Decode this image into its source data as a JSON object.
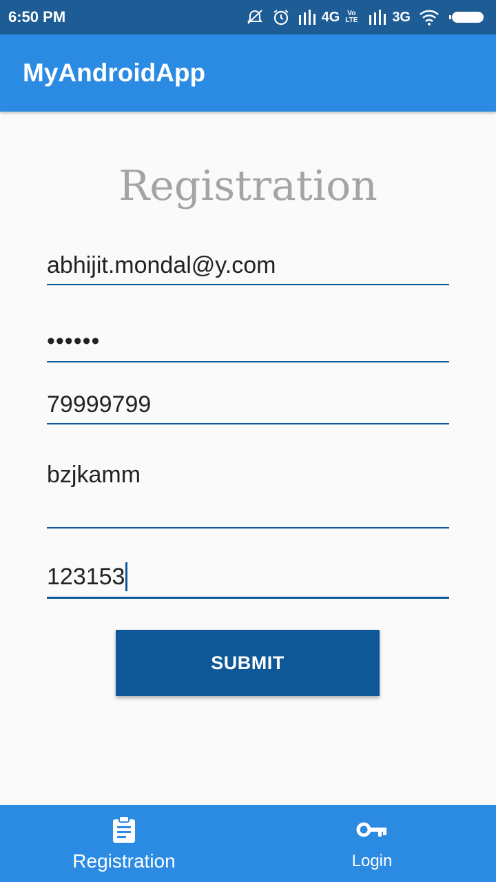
{
  "status_bar": {
    "time": "6:50 PM",
    "network_1": "4G",
    "volte": "Vo LTE",
    "network_2": "3G"
  },
  "app_bar": {
    "title": "MyAndroidApp"
  },
  "form": {
    "title": "Registration",
    "fields": [
      {
        "value": "abhijit.mondal@y.com"
      },
      {
        "value": "••••••"
      },
      {
        "value": "79999799"
      },
      {
        "value": "bzjkamm"
      },
      {
        "value": "123153"
      }
    ],
    "submit_label": "SUBMIT"
  },
  "bottom_nav": {
    "items": [
      {
        "label": "Registration",
        "icon": "clipboard-icon",
        "selected": true
      },
      {
        "label": "Login",
        "icon": "key-icon",
        "selected": false
      }
    ]
  },
  "colors": {
    "status_bar": "#1e5c96",
    "primary": "#2b8be3",
    "accent": "#0f5897",
    "title_gray": "#a4a4a4"
  }
}
